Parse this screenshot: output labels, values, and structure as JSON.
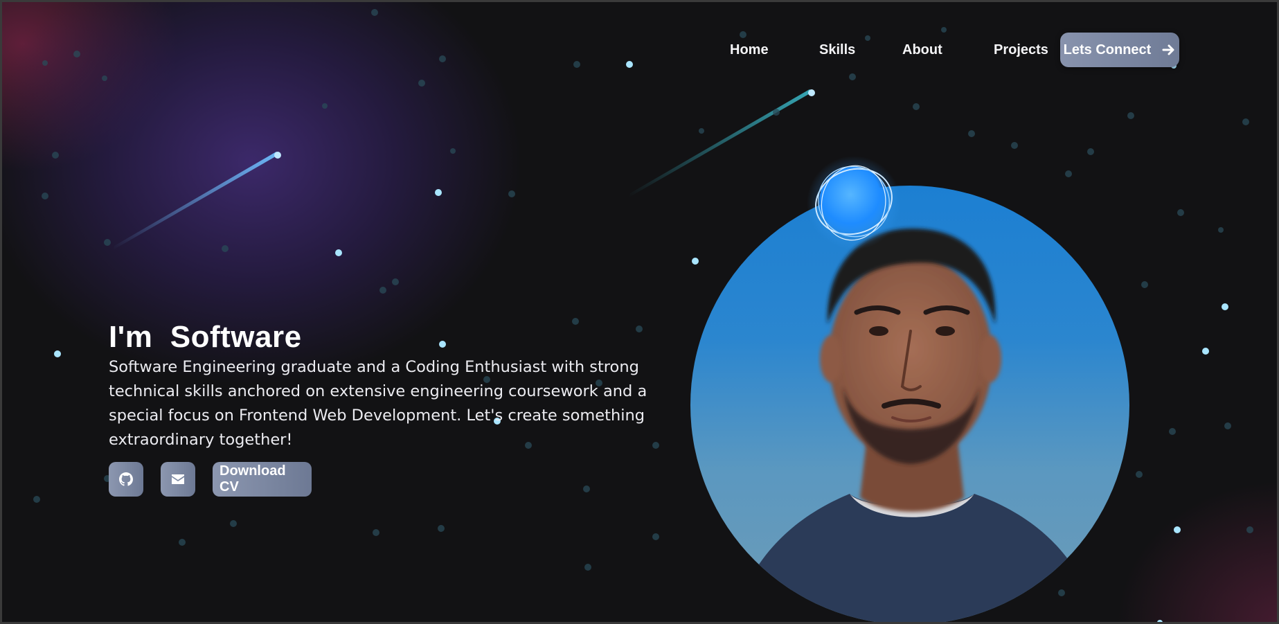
{
  "nav": {
    "links": [
      "Home",
      "Skills",
      "About",
      "Projects"
    ],
    "cta_label": "Lets Connect",
    "cta_icon": "arrow-right-icon"
  },
  "hero": {
    "title": "I'm  Software",
    "description": "Software Engineering graduate and a Coding Enthusiast with strong technical skills anchored on extensive engineering coursework and a special focus on Frontend Web Development. Let's create something extraordinary together!",
    "github_icon": "github-icon",
    "email_icon": "envelope-icon",
    "download_label": "Download CV"
  },
  "colors": {
    "background": "#121214",
    "button": "#7d88a3",
    "avatar_bg": "#1c7fd2",
    "star": "#a8e4ff"
  }
}
